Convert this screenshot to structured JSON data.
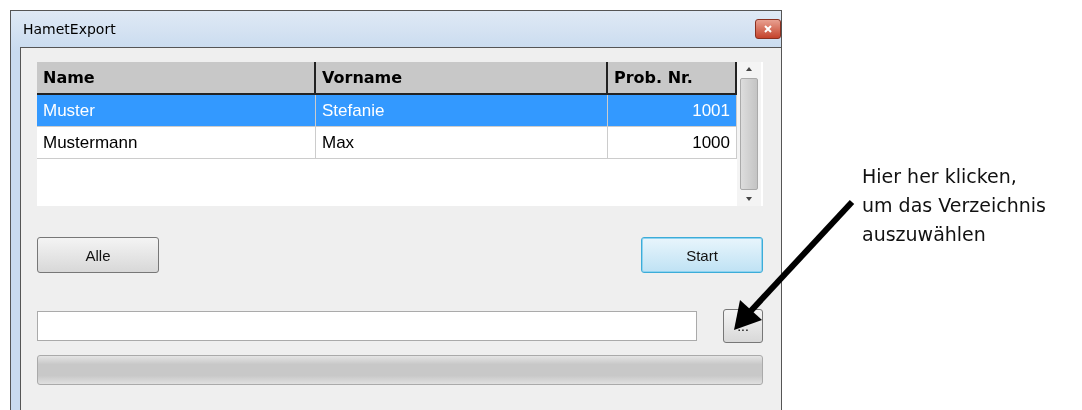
{
  "window": {
    "title": "HametExport"
  },
  "table": {
    "columns": [
      {
        "label": "Name"
      },
      {
        "label": "Vorname"
      },
      {
        "label": "Prob. Nr."
      }
    ],
    "rows": [
      {
        "cells": [
          "Muster",
          "Stefanie",
          "1001"
        ],
        "selected": true
      },
      {
        "cells": [
          "Mustermann",
          "Max",
          "1000"
        ],
        "selected": false
      }
    ]
  },
  "buttons": [
    {
      "label": "Alle",
      "focused": false
    },
    {
      "label": "Start",
      "focused": true
    }
  ],
  "browse_button": {
    "label": "..."
  },
  "progress": {
    "level": 0
  },
  "annotation": {
    "lines": [
      "Hier her klicken,",
      "um das Verzeichnis",
      "auszuwählen"
    ]
  }
}
